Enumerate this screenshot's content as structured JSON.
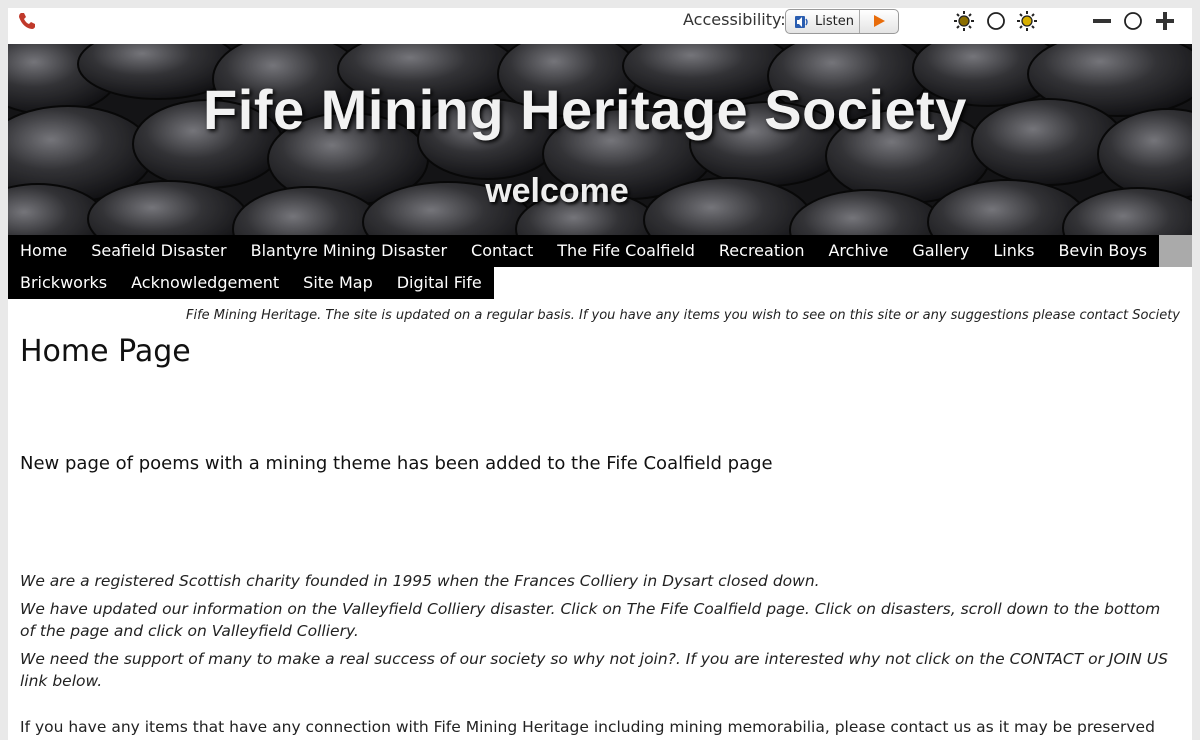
{
  "topbar": {
    "accessibility_label": "Accessibility:",
    "listen_label": "Listen",
    "icons": [
      "phone-icon",
      "speaker-icon",
      "play-icon",
      "brightness-low-icon",
      "contrast-reset-icon",
      "brightness-high-icon",
      "zoom-out-icon",
      "zoom-reset-icon",
      "zoom-in-icon"
    ]
  },
  "banner": {
    "title": "Fife Mining Heritage Society",
    "subtitle": "welcome"
  },
  "nav": {
    "row1": [
      "Home",
      "Seafield Disaster",
      "Blantyre Mining Disaster",
      "Contact",
      "The Fife Coalfield",
      "Recreation",
      "Archive",
      "Gallery",
      "Links",
      "Bevin Boys"
    ],
    "row2": [
      "Brickworks",
      "Acknowledgement",
      "Site Map",
      "Digital Fife"
    ]
  },
  "notice": "Fife Mining Heritage. The site is updated on a regular basis. If you have any items you wish to see on this site or any suggestions please contact Society",
  "main": {
    "page_title": "Home Page",
    "headline": "New page of poems with a mining theme has been added to the Fife Coalfield page",
    "paragraphs": [
      "We are a registered Scottish charity founded in 1995 when the Frances Colliery in Dysart closed down.",
      "We have updated our information on the Valleyfield Colliery disaster. Click on The Fife Coalfield page. Click on disasters, scroll down to the bottom of the page and click on Valleyfield Colliery.",
      "We need the support of many to make a real success of our society so why not join?. If you are interested why not click on the CONTACT or JOIN US link below."
    ],
    "cutoff_line": "If you have any items that have any connection with Fife Mining Heritage including mining memorabilia, please contact us as it may be preserved"
  },
  "colors": {
    "nav_bg": "#000000",
    "nav_text": "#ffffff",
    "phone": "#c0392b",
    "play": "#e86c0a"
  }
}
